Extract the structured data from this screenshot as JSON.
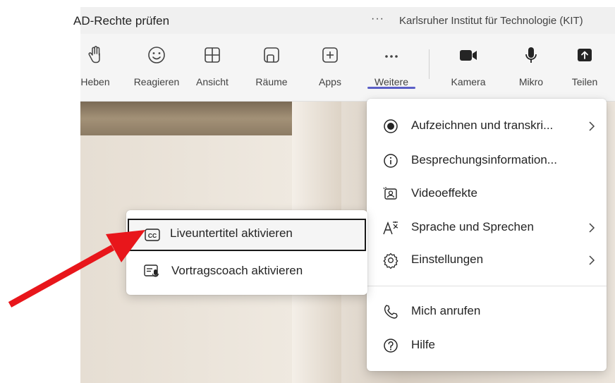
{
  "window": {
    "title": "AD-Rechte prüfen",
    "more_dots": "···",
    "organization": "Karlsruher Institut für Technologie (KIT)"
  },
  "toolbar": {
    "buttons": [
      {
        "label": "Heben",
        "icon": "raise-hand-icon"
      },
      {
        "label": "Reagieren",
        "icon": "smiley-icon"
      },
      {
        "label": "Ansicht",
        "icon": "grid-view-icon"
      },
      {
        "label": "Räume",
        "icon": "rooms-icon"
      },
      {
        "label": "Apps",
        "icon": "add-app-icon"
      },
      {
        "label": "Weitere",
        "icon": "more-icon",
        "active": true
      },
      {
        "label": "Kamera",
        "icon": "camera-icon"
      },
      {
        "label": "Mikro",
        "icon": "microphone-icon"
      },
      {
        "label": "Teilen",
        "icon": "share-icon"
      }
    ]
  },
  "more_menu": {
    "items": [
      {
        "label": "Aufzeichnen und transkri...",
        "icon": "record-icon",
        "submenu": true
      },
      {
        "label": "Besprechungsinformation...",
        "icon": "info-icon",
        "submenu": false
      },
      {
        "label": "Videoeffekte",
        "icon": "video-effects-icon",
        "submenu": false
      },
      {
        "label": "Sprache und Sprechen",
        "icon": "language-icon",
        "submenu": true
      },
      {
        "label": "Einstellungen",
        "icon": "gear-icon",
        "submenu": true
      },
      {
        "label": "Mich anrufen",
        "icon": "phone-icon",
        "submenu": false
      },
      {
        "label": "Hilfe",
        "icon": "help-icon",
        "submenu": false
      }
    ]
  },
  "language_submenu": {
    "items": [
      {
        "label": "Liveuntertitel aktivieren",
        "icon": "closed-captions-icon",
        "highlighted": true
      },
      {
        "label": "Vortragscoach aktivieren",
        "icon": "speaker-coach-icon",
        "highlighted": false
      }
    ]
  },
  "colors": {
    "accent": "#5b5fc7",
    "annotation_arrow": "#e8161b",
    "toolbar_bg": "#f5f5f5",
    "menu_bg": "#ffffff"
  }
}
